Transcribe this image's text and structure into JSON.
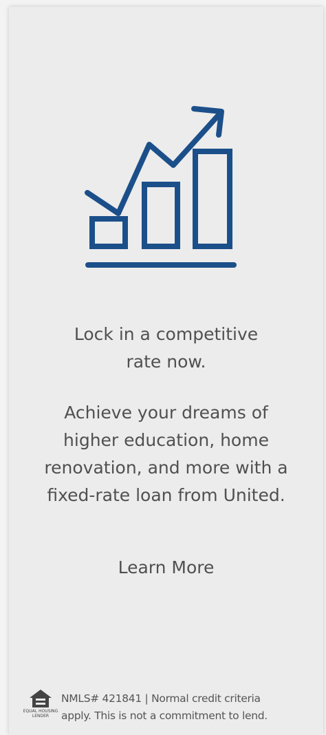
{
  "ad": {
    "headline": "Lock in a competitive rate now.",
    "body": "Achieve your dreams of higher education, home renovation, and more with a fixed-rate loan from United.",
    "cta_label": "Learn More",
    "icon": "growth-chart-icon",
    "brand_color": "#1b4f8a"
  },
  "footer": {
    "logo_icon": "equal-housing-lender-icon",
    "logo_text_top": "EQUAL HOUSING",
    "logo_text_bottom": "LENDER",
    "disclaimer_line1": "NMLS# 421841 | Normal credit criteria",
    "disclaimer_line2": "apply. This is not a commitment to lend."
  }
}
